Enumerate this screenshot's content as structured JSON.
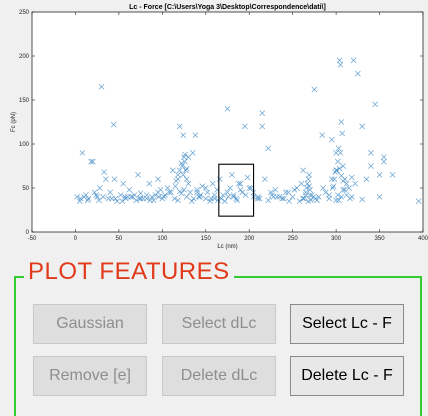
{
  "chart_data": {
    "type": "scatter",
    "title": "Lc - Force [C:\\Users\\Yoga 3\\Desktop\\Correspondence\\dati\\]",
    "xlabel": "Lc (nm)",
    "ylabel": "Fc (pN)",
    "xlim": [
      -50,
      400
    ],
    "ylim": [
      0,
      250
    ],
    "xticks": [
      "-50",
      "0",
      "50",
      "100",
      "150",
      "200",
      "250",
      "300",
      "350",
      "400"
    ],
    "yticks": [
      "0",
      "50",
      "100",
      "150",
      "200",
      "250"
    ],
    "marker": "x",
    "color": "#4a90c9",
    "selection_box": {
      "x": [
        165,
        205
      ],
      "y": [
        18,
        77
      ]
    },
    "x": [
      5,
      8,
      12,
      15,
      18,
      22,
      25,
      28,
      30,
      35,
      38,
      40,
      44,
      48,
      52,
      55,
      58,
      62,
      66,
      70,
      72,
      75,
      78,
      82,
      85,
      88,
      90,
      95,
      98,
      100,
      103,
      106,
      110,
      112,
      115,
      118,
      120,
      122,
      123,
      124,
      125,
      126,
      127,
      128,
      130,
      132,
      135,
      138,
      140,
      143,
      146,
      150,
      155,
      158,
      160,
      163,
      166,
      170,
      172,
      175,
      178,
      180,
      182,
      185,
      188,
      190,
      195,
      198,
      200,
      205,
      210,
      215,
      218,
      222,
      226,
      230,
      235,
      238,
      242,
      246,
      250,
      255,
      258,
      262,
      265,
      266,
      267,
      268,
      269,
      270,
      272,
      274,
      276,
      280,
      284,
      288,
      292,
      295,
      298,
      300,
      301,
      302,
      303,
      304,
      305,
      306,
      307,
      308,
      310,
      312,
      315,
      318,
      320,
      325,
      330,
      335,
      340,
      345,
      350,
      355,
      20,
      33,
      45,
      60,
      75,
      95,
      120,
      125,
      130,
      140,
      150,
      160,
      175,
      190,
      205,
      215,
      225,
      240,
      260,
      270,
      275,
      285,
      295,
      300,
      305,
      308,
      312,
      318,
      322,
      340,
      355,
      365,
      395,
      10,
      27,
      42,
      57,
      68,
      82,
      96,
      108,
      118,
      128,
      136,
      144,
      152,
      168,
      176,
      186,
      196,
      210,
      228,
      245,
      262,
      278,
      292,
      306,
      316,
      330,
      350,
      300,
      302,
      304,
      306,
      308,
      310,
      303,
      299,
      297,
      296,
      120,
      122,
      124,
      126,
      128,
      118,
      116,
      269,
      271,
      265,
      263,
      268,
      2,
      6,
      14,
      24,
      32,
      46,
      54,
      64,
      74,
      86,
      92,
      102,
      114,
      134,
      142,
      156,
      164,
      182,
      192,
      202,
      212,
      222,
      232,
      252,
      258,
      272,
      282,
      298,
      302,
      306
    ],
    "y": [
      35,
      90,
      42,
      38,
      80,
      45,
      40,
      50,
      165,
      60,
      38,
      45,
      122,
      35,
      42,
      55,
      38,
      48,
      40,
      36,
      65,
      44,
      38,
      42,
      55,
      40,
      36,
      60,
      48,
      38,
      42,
      50,
      45,
      70,
      52,
      60,
      70,
      78,
      75,
      65,
      85,
      80,
      70,
      60,
      55,
      45,
      90,
      110,
      48,
      40,
      52,
      50,
      35,
      55,
      38,
      48,
      60,
      42,
      35,
      45,
      50,
      65,
      40,
      38,
      55,
      48,
      120,
      62,
      50,
      45,
      40,
      135,
      60,
      95,
      42,
      48,
      40,
      38,
      45,
      35,
      40,
      50,
      35,
      70,
      45,
      50,
      55,
      60,
      65,
      48,
      42,
      40,
      38,
      40,
      110,
      45,
      38,
      105,
      60,
      90,
      70,
      80,
      95,
      195,
      190,
      125,
      112,
      75,
      60,
      55,
      50,
      40,
      195,
      180,
      120,
      60,
      75,
      145,
      65,
      85,
      80,
      68,
      60,
      40,
      38,
      45,
      120,
      48,
      85,
      45,
      38,
      42,
      140,
      55,
      40,
      120,
      45,
      38,
      55,
      42,
      162,
      50,
      60,
      70,
      90,
      48,
      42,
      62,
      55,
      90,
      80,
      65,
      35,
      40,
      36,
      38,
      40,
      42,
      38,
      40,
      45,
      36,
      40,
      38,
      42,
      45,
      38,
      40,
      36,
      42,
      38,
      40,
      45,
      38,
      36,
      42,
      40,
      38,
      37,
      40,
      36,
      42,
      72,
      64,
      58,
      48,
      36,
      68,
      52,
      50,
      46,
      44,
      110,
      88,
      72,
      65,
      58,
      52,
      36,
      42,
      38,
      35,
      40,
      38,
      36,
      42,
      40,
      38,
      35,
      40,
      38,
      36,
      42,
      40,
      38,
      35,
      40,
      38,
      36,
      42,
      45,
      50,
      38,
      36,
      40,
      48
    ]
  },
  "panel": {
    "title": "PLOT FEATURES",
    "buttons": [
      {
        "label": "Gaussian",
        "enabled": false
      },
      {
        "label": "Select  dLc",
        "enabled": false
      },
      {
        "label": "Select Lc - F",
        "enabled": true
      },
      {
        "label": "Remove [e]",
        "enabled": false
      },
      {
        "label": "Delete dLc",
        "enabled": false
      },
      {
        "label": "Delete Lc - F",
        "enabled": true
      }
    ]
  }
}
